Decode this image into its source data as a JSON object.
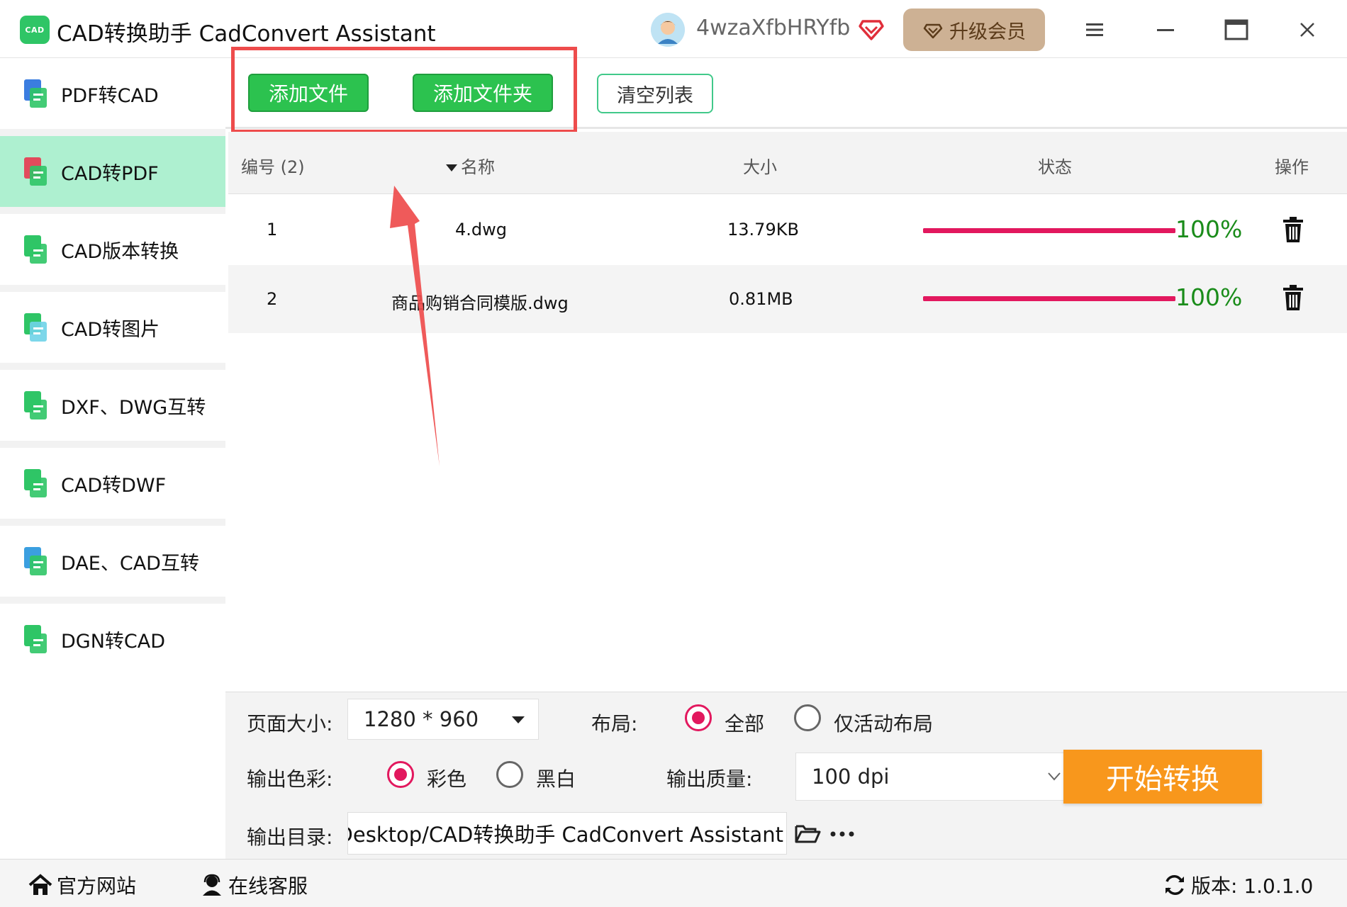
{
  "app": {
    "logo_text": "CAD",
    "title": "CAD转换助手 CadConvert Assistant",
    "username": "4wzaXfbHRYfb",
    "upgrade_label": "升级会员"
  },
  "sidebar": {
    "items": [
      {
        "label": "PDF转CAD",
        "icon": "pdf-to-cad-icon"
      },
      {
        "label": "CAD转PDF",
        "icon": "cad-to-pdf-icon",
        "active": true
      },
      {
        "label": "CAD版本转换",
        "icon": "cad-version-icon"
      },
      {
        "label": "CAD转图片",
        "icon": "cad-to-image-icon"
      },
      {
        "label": "DXF、DWG互转",
        "icon": "dxf-dwg-icon"
      },
      {
        "label": "CAD转DWF",
        "icon": "cad-to-dwf-icon"
      },
      {
        "label": "DAE、CAD互转",
        "icon": "dae-cad-icon"
      },
      {
        "label": "DGN转CAD",
        "icon": "dgn-to-cad-icon"
      }
    ]
  },
  "toolbar": {
    "add_file": "添加文件",
    "add_folder": "添加文件夹",
    "clear_list": "清空列表"
  },
  "table": {
    "columns": {
      "index": "编号 (2)",
      "name": "名称",
      "size": "大小",
      "status": "状态",
      "action": "操作"
    },
    "rows": [
      {
        "index": "1",
        "name": "4.dwg",
        "size": "13.79KB",
        "progress": 1.0,
        "progress_text": "100%"
      },
      {
        "index": "2",
        "name": "商品购销合同模版.dwg",
        "size": "0.81MB",
        "progress": 1.0,
        "progress_text": "100%"
      }
    ]
  },
  "settings": {
    "page_size_label": "页面大小:",
    "page_size_value": "1280 * 960",
    "layout_label": "布局:",
    "layout_all": "全部",
    "layout_active": "仅活动布局",
    "color_label": "输出色彩:",
    "color_color": "彩色",
    "color_bw": "黑白",
    "quality_label": "输出质量:",
    "quality_value": "100 dpi",
    "start_label": "开始转换",
    "output_dir_label": "输出目录:",
    "output_dir_value": "面/Desktop/CAD转换助手 CadConvert Assistant"
  },
  "statusbar": {
    "website": "官方网站",
    "support": "在线客服",
    "version": "版本: 1.0.1.0"
  },
  "colors": {
    "accent_green": "#2cc24f",
    "active_nav": "#aef0d0",
    "progress": "#e2185e",
    "start_button": "#f8971c",
    "annotation": "#ee4c4c"
  }
}
